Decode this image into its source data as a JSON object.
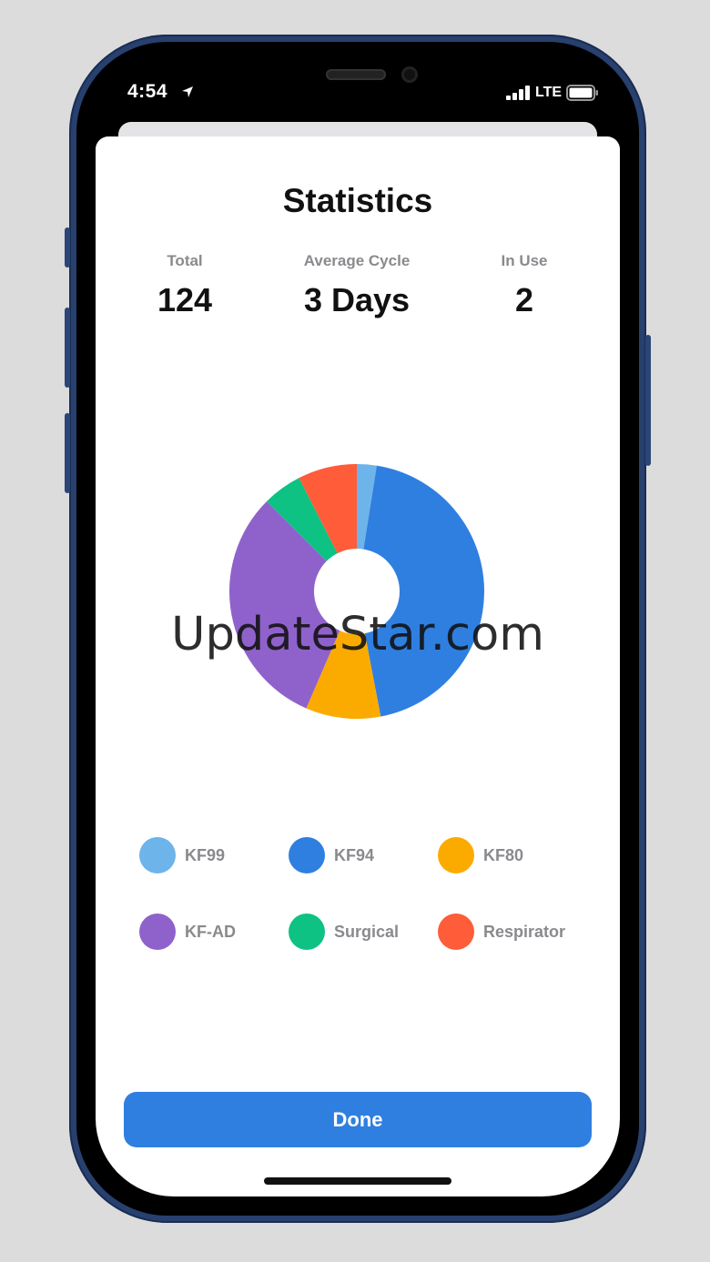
{
  "status_bar": {
    "time": "4:54",
    "network": "LTE",
    "icons": [
      "location-arrow-icon",
      "signal-bars-icon",
      "battery-icon"
    ]
  },
  "sheet": {
    "title": "Statistics",
    "stats": [
      {
        "label": "Total",
        "value": "124"
      },
      {
        "label": "Average Cycle",
        "value": "3 Days"
      },
      {
        "label": "In Use",
        "value": "2"
      }
    ],
    "done_label": "Done"
  },
  "watermark": "UpdateStar.com",
  "chart_data": {
    "type": "pie",
    "donut": true,
    "categories": [
      "KF99",
      "KF94",
      "KF80",
      "KF-AD",
      "Surgical",
      "Respirator"
    ],
    "values": [
      2.5,
      44.5,
      9.5,
      31,
      5,
      7.5
    ],
    "colors": [
      "#6db4ea",
      "#2f7fe0",
      "#fbab00",
      "#8f62cb",
      "#0dc282",
      "#ff5c3a"
    ],
    "legend": "bottom"
  }
}
